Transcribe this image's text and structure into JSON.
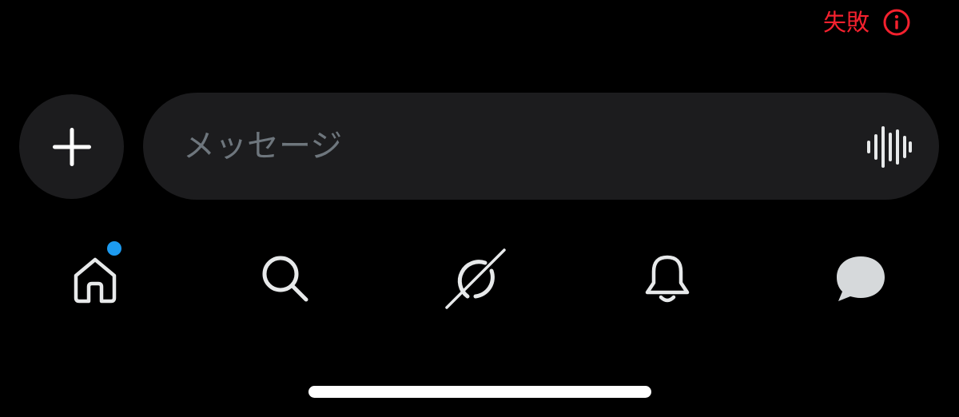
{
  "status": {
    "text": "失敗",
    "icon": "info-circle-icon",
    "color": "#f4212e"
  },
  "composer": {
    "plus_icon": "plus-icon",
    "placeholder": "メッセージ",
    "voice_icon": "voice-waveform-icon"
  },
  "nav": {
    "items": [
      {
        "id": "home",
        "icon": "home-icon",
        "has_badge": true
      },
      {
        "id": "search",
        "icon": "search-icon"
      },
      {
        "id": "grok",
        "icon": "grok-icon"
      },
      {
        "id": "notifications",
        "icon": "bell-icon"
      },
      {
        "id": "messages",
        "icon": "chat-bubble-icon"
      }
    ]
  },
  "colors": {
    "background": "#000000",
    "surface": "#1c1c1e",
    "accent": "#1d9bf0",
    "error": "#f4212e",
    "icon": "#e7e9ea",
    "placeholder": "#6e767d"
  }
}
